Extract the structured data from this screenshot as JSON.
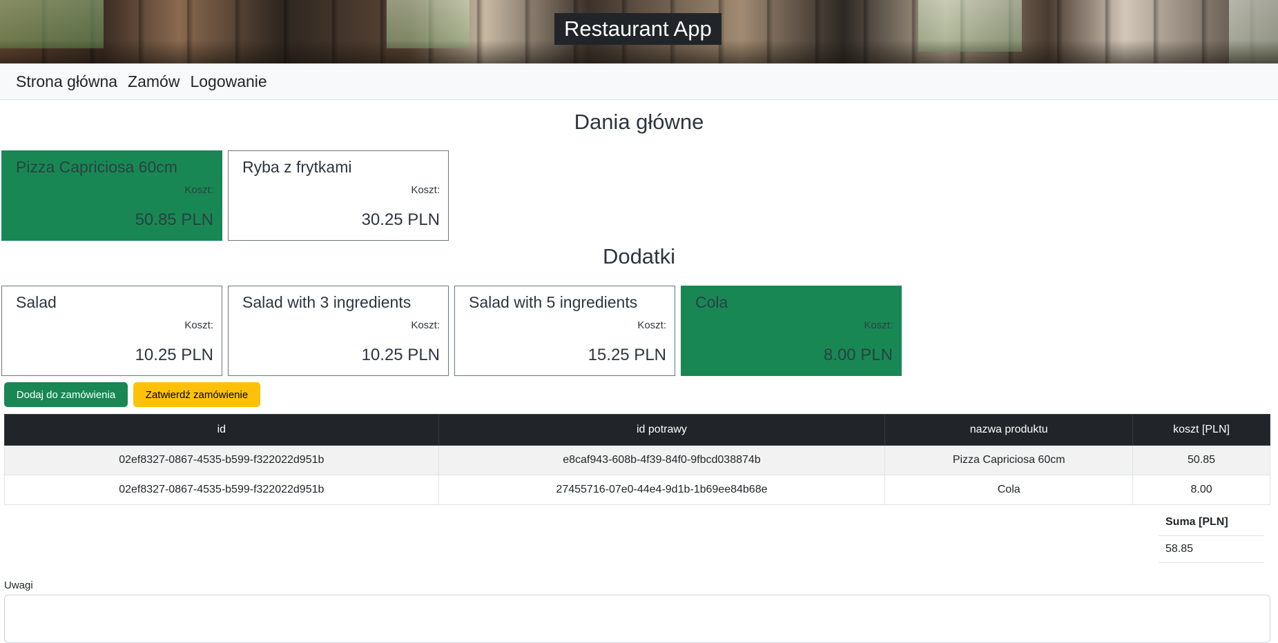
{
  "header": {
    "title": "Restaurant App"
  },
  "nav": {
    "items": [
      "Strona główna",
      "Zamów",
      "Logowanie"
    ]
  },
  "sections": {
    "main_dishes": {
      "title": "Dania główne",
      "items": [
        {
          "name": "Pizza Capriciosa 60cm",
          "cost_label": "Koszt:",
          "price": "50.85 PLN",
          "selected": true
        },
        {
          "name": "Ryba z frytkami",
          "cost_label": "Koszt:",
          "price": "30.25 PLN",
          "selected": false
        }
      ]
    },
    "extras": {
      "title": "Dodatki",
      "items": [
        {
          "name": "Salad",
          "cost_label": "Koszt:",
          "price": "10.25 PLN",
          "selected": false
        },
        {
          "name": "Salad with 3 ingredients",
          "cost_label": "Koszt:",
          "price": "10.25 PLN",
          "selected": false
        },
        {
          "name": "Salad with 5 ingredients",
          "cost_label": "Koszt:",
          "price": "15.25 PLN",
          "selected": false
        },
        {
          "name": "Cola",
          "cost_label": "Koszt:",
          "price": "8.00 PLN",
          "selected": true
        }
      ]
    }
  },
  "buttons": {
    "add": "Dodaj do zamówienia",
    "confirm": "Zatwierdź zamówienie"
  },
  "orders_table": {
    "headers": [
      "id",
      "id potrawy",
      "nazwa produktu",
      "koszt [PLN]"
    ],
    "rows": [
      [
        "02ef8327-0867-4535-b599-f322022d951b",
        "e8caf943-608b-4f39-84f0-9fbcd038874b",
        "Pizza Capriciosa 60cm",
        "50.85"
      ],
      [
        "02ef8327-0867-4535-b599-f322022d951b",
        "27455716-07e0-44e4-9d1b-1b69ee84b68e",
        "Cola",
        "8.00"
      ]
    ]
  },
  "sum_table": {
    "header": "Suma [PLN]",
    "value": "58.85"
  },
  "notes": {
    "label": "Uwagi",
    "value": ""
  },
  "colors": {
    "selected_card": "#198754",
    "add_button": "#198754",
    "confirm_button": "#ffc107",
    "table_header": "#212529",
    "app_title_bg": "#212529"
  }
}
